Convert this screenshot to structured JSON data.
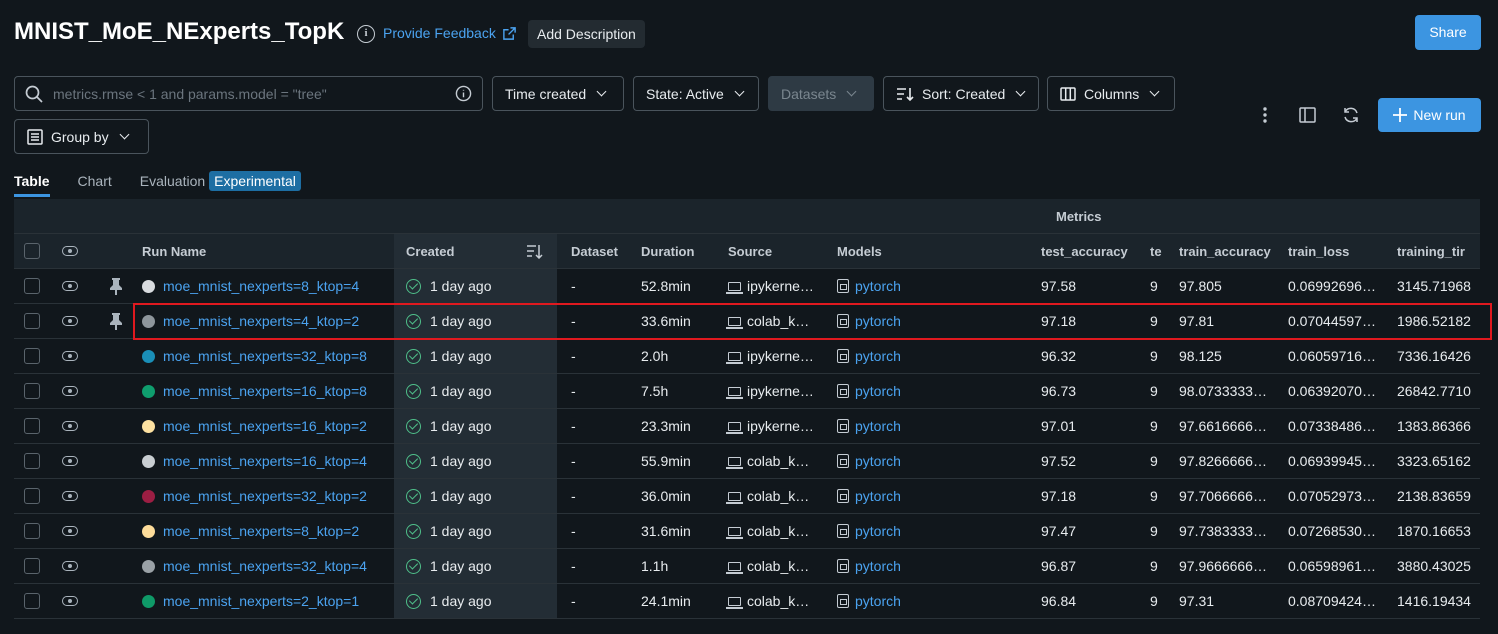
{
  "page": {
    "title": "MNIST_MoE_NExperts_TopK",
    "feedback_label": "Provide Feedback",
    "add_description_label": "Add Description",
    "share_label": "Share"
  },
  "toolbar": {
    "search_placeholder": "metrics.rmse < 1 and params.model = \"tree\"",
    "time_created": "Time created",
    "state": "State: Active",
    "datasets": "Datasets",
    "sort": "Sort: Created",
    "columns": "Columns",
    "group_by": "Group by",
    "new_run": "New run"
  },
  "tabs": [
    {
      "label": "Table",
      "active": true
    },
    {
      "label": "Chart",
      "active": false
    },
    {
      "label": "Evaluation",
      "active": false,
      "badge": "Experimental"
    }
  ],
  "table": {
    "group_header": "Metrics",
    "columns": [
      "Run Name",
      "Created",
      "Dataset",
      "Duration",
      "Source",
      "Models",
      "test_accuracy",
      "te",
      "train_accuracy",
      "train_loss",
      "training_tir"
    ],
    "rows": [
      {
        "name": "moe_mnist_nexperts=8_ktop=4",
        "color": "#d9dcdf",
        "pinned": true,
        "created": "1 day ago",
        "dataset": "-",
        "duration": "52.8min",
        "source": "ipykerne…",
        "model": "pytorch",
        "test_accuracy": "97.58",
        "te": "9",
        "train_accuracy": "97.805",
        "train_loss": "0.06992696…",
        "training_time": "3145.71968"
      },
      {
        "name": "moe_mnist_nexperts=4_ktop=2",
        "color": "#8e969c",
        "pinned": true,
        "created": "1 day ago",
        "dataset": "-",
        "duration": "33.6min",
        "source": "colab_k…",
        "model": "pytorch",
        "test_accuracy": "97.18",
        "te": "9",
        "train_accuracy": "97.81",
        "train_loss": "0.07044597…",
        "training_time": "1986.52182"
      },
      {
        "name": "moe_mnist_nexperts=32_ktop=8",
        "color": "#1a8fb8",
        "pinned": false,
        "created": "1 day ago",
        "dataset": "-",
        "duration": "2.0h",
        "source": "ipykerne…",
        "model": "pytorch",
        "test_accuracy": "96.32",
        "te": "9",
        "train_accuracy": "98.125",
        "train_loss": "0.06059716…",
        "training_time": "7336.16426"
      },
      {
        "name": "moe_mnist_nexperts=16_ktop=8",
        "color": "#0f9e6e",
        "pinned": false,
        "created": "1 day ago",
        "dataset": "-",
        "duration": "7.5h",
        "source": "ipykerne…",
        "model": "pytorch",
        "test_accuracy": "96.73",
        "te": "9",
        "train_accuracy": "98.0733333…",
        "train_loss": "0.06392070…",
        "training_time": "26842.7710"
      },
      {
        "name": "moe_mnist_nexperts=16_ktop=2",
        "color": "#fde1a1",
        "pinned": false,
        "created": "1 day ago",
        "dataset": "-",
        "duration": "23.3min",
        "source": "ipykerne…",
        "model": "pytorch",
        "test_accuracy": "97.01",
        "te": "9",
        "train_accuracy": "97.6616666…",
        "train_loss": "0.07338486…",
        "training_time": "1383.86366"
      },
      {
        "name": "moe_mnist_nexperts=16_ktop=4",
        "color": "#c9ced2",
        "pinned": false,
        "created": "1 day ago",
        "dataset": "-",
        "duration": "55.9min",
        "source": "colab_k…",
        "model": "pytorch",
        "test_accuracy": "97.52",
        "te": "9",
        "train_accuracy": "97.8266666…",
        "train_loss": "0.06939945…",
        "training_time": "3323.65162"
      },
      {
        "name": "moe_mnist_nexperts=32_ktop=2",
        "color": "#9c1e43",
        "pinned": false,
        "created": "1 day ago",
        "dataset": "-",
        "duration": "36.0min",
        "source": "colab_k…",
        "model": "pytorch",
        "test_accuracy": "97.18",
        "te": "9",
        "train_accuracy": "97.7066666…",
        "train_loss": "0.07052973…",
        "training_time": "2138.83659"
      },
      {
        "name": "moe_mnist_nexperts=8_ktop=2",
        "color": "#fddc9a",
        "pinned": false,
        "created": "1 day ago",
        "dataset": "-",
        "duration": "31.6min",
        "source": "colab_k…",
        "model": "pytorch",
        "test_accuracy": "97.47",
        "te": "9",
        "train_accuracy": "97.7383333…",
        "train_loss": "0.07268530…",
        "training_time": "1870.16653"
      },
      {
        "name": "moe_mnist_nexperts=32_ktop=4",
        "color": "#9aa1a6",
        "pinned": false,
        "created": "1 day ago",
        "dataset": "-",
        "duration": "1.1h",
        "source": "colab_k…",
        "model": "pytorch",
        "test_accuracy": "96.87",
        "te": "9",
        "train_accuracy": "97.9666666…",
        "train_loss": "0.06598961…",
        "training_time": "3880.43025"
      },
      {
        "name": "moe_mnist_nexperts=2_ktop=1",
        "color": "#0f9a68",
        "pinned": false,
        "created": "1 day ago",
        "dataset": "-",
        "duration": "24.1min",
        "source": "colab_k…",
        "model": "pytorch",
        "test_accuracy": "96.84",
        "te": "9",
        "train_accuracy": "97.31",
        "train_loss": "0.08709424…",
        "training_time": "1416.19434"
      }
    ]
  }
}
